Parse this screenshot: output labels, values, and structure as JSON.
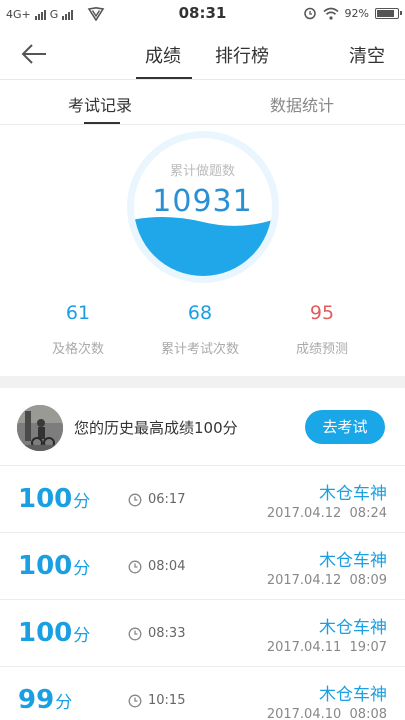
{
  "status_bar": {
    "network_left": "4G+",
    "network_right": "G",
    "time": "08:31",
    "battery": "92%",
    "battery_level": 0.92
  },
  "nav": {
    "back_icon": "arrow-left-icon",
    "tabs": [
      {
        "label": "成绩",
        "active": true
      },
      {
        "label": "排行榜",
        "active": false
      }
    ],
    "clear_label": "清空"
  },
  "sub_tabs": [
    {
      "label": "考试记录",
      "active": true
    },
    {
      "label": "数据统计",
      "active": false
    }
  ],
  "summary": {
    "ring_label": "累计做题数",
    "ring_value": "10931",
    "stats": [
      {
        "value": "61",
        "label": "及格次数",
        "color": "#1aa0e2"
      },
      {
        "value": "68",
        "label": "累计考试次数",
        "color": "#1aa0e2"
      },
      {
        "value": "95",
        "label": "成绩预测",
        "color": "#e35b5b"
      }
    ]
  },
  "best": {
    "text": "您的历史最高成绩100分",
    "button_label": "去考试"
  },
  "records": [
    {
      "score": "100",
      "unit": "分",
      "duration": "06:17",
      "name": "木仓车神",
      "date": "2017.04.12  08:24"
    },
    {
      "score": "100",
      "unit": "分",
      "duration": "08:04",
      "name": "木仓车神",
      "date": "2017.04.12  08:09"
    },
    {
      "score": "100",
      "unit": "分",
      "duration": "08:33",
      "name": "木仓车神",
      "date": "2017.04.11  19:07"
    },
    {
      "score": "99",
      "unit": "分",
      "duration": "10:15",
      "name": "木仓车神",
      "date": "2017.04.10  08:08"
    }
  ],
  "colors": {
    "accent": "#1aa0e2",
    "button": "#1aa7e8",
    "danger": "#e35b5b"
  }
}
